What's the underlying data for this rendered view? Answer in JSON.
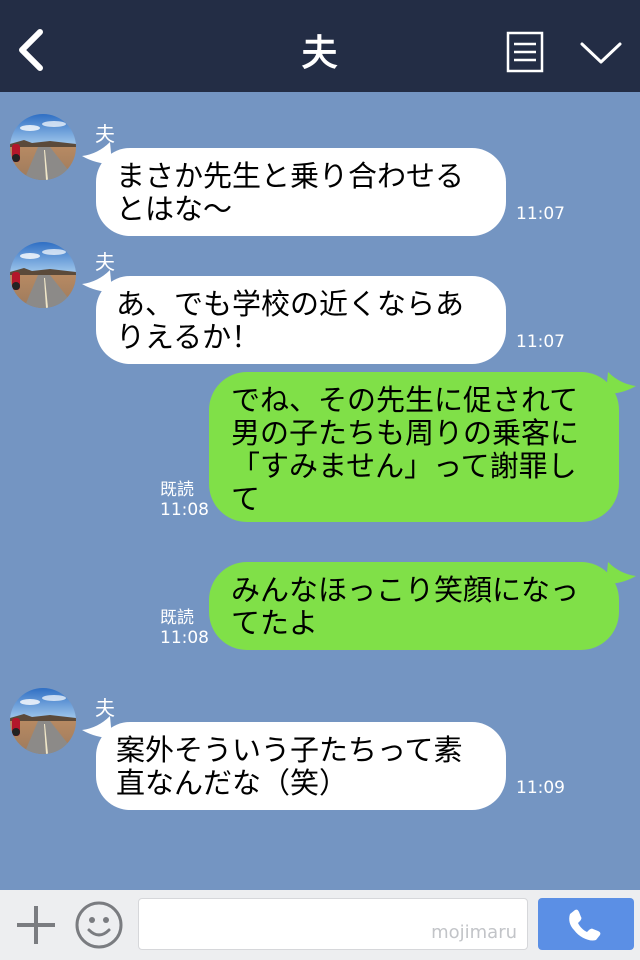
{
  "header": {
    "title": "夫",
    "back_icon": "chevron-left-icon",
    "menu_icon": "document-menu-icon",
    "more_icon": "chevron-down-icon"
  },
  "colors": {
    "header_bg": "#232d45",
    "chat_bg": "#7495c2",
    "incoming_bubble": "#ffffff",
    "outgoing_bubble": "#80e048",
    "call_button": "#5b8fe5"
  },
  "messages": [
    {
      "direction": "incoming",
      "sender": "夫",
      "lines": [
        "まさか先生と乗り合わせる",
        "とはな〜"
      ],
      "time": "11:07"
    },
    {
      "direction": "incoming",
      "sender": "夫",
      "lines": [
        "あ、でも学校の近くならあ",
        "りえるか！"
      ],
      "time": "11:07"
    },
    {
      "direction": "outgoing",
      "lines": [
        "でね、その先生に促されて",
        "男の子たちも周りの乗客に",
        "「すみません」って謝罪し",
        "て"
      ],
      "read": "既読",
      "time": "11:08"
    },
    {
      "direction": "outgoing",
      "lines": [
        "みんなほっこり笑顔になっ",
        "てたよ"
      ],
      "read": "既読",
      "time": "11:08"
    },
    {
      "direction": "incoming",
      "sender": "夫",
      "lines": [
        "案外そういう子たちって素",
        "直なんだな（笑）"
      ],
      "time": "11:09"
    }
  ],
  "footer": {
    "watermark": "mojimaru",
    "plus_icon": "plus-icon",
    "emoji_icon": "smiley-icon",
    "call_icon": "phone-icon"
  }
}
